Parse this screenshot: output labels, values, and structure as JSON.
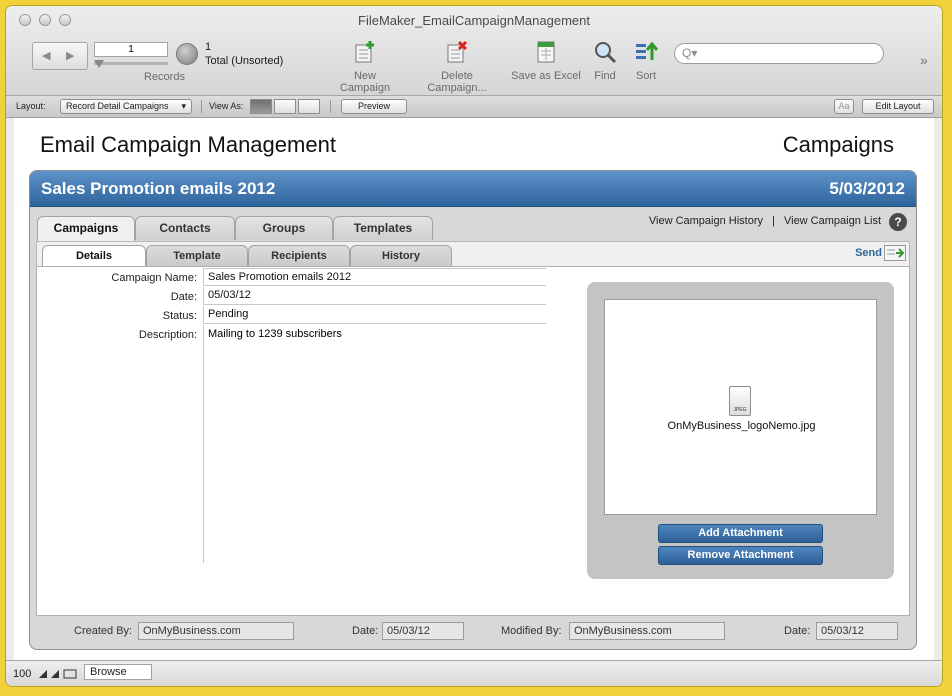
{
  "window": {
    "title": "FileMaker_EmailCampaignManagement"
  },
  "toolbar": {
    "record_number": "1",
    "record_count": "1",
    "found_status": "Total (Unsorted)",
    "records_label": "Records",
    "new_campaign": "New Campaign",
    "delete_campaign": "Delete Campaign...",
    "save_excel": "Save as Excel",
    "find": "Find",
    "sort": "Sort",
    "search_placeholder": "Q▾"
  },
  "layoutbar": {
    "layout_label": "Layout:",
    "layout_value": "Record Detail Campaigns",
    "view_as_label": "View As:",
    "preview": "Preview",
    "aa": "Aa",
    "edit_layout": "Edit Layout"
  },
  "header": {
    "title": "Email Campaign Management",
    "section": "Campaigns"
  },
  "campaign": {
    "name": "Sales Promotion emails 2012",
    "date": "5/03/2012"
  },
  "main_tabs": [
    "Campaigns",
    "Contacts",
    "Groups",
    "Templates"
  ],
  "links": {
    "history": "View Campaign History",
    "separator": "|",
    "list": "View Campaign List",
    "help": "?"
  },
  "sub_tabs": [
    "Details",
    "Template",
    "Recipients",
    "History"
  ],
  "send_label": "Send",
  "fields": {
    "name_label": "Campaign Name:",
    "name_value": "Sales Promotion emails 2012",
    "date_label": "Date:",
    "date_value": "05/03/12",
    "status_label": "Status:",
    "status_value": "Pending",
    "desc_label": "Description:",
    "desc_value": "Mailing to 1239 subscribers"
  },
  "attachment": {
    "file_type": "JPEG",
    "file_name": "OnMyBusiness_logoNemo.jpg",
    "add_button": "Add Attachment",
    "remove_button": "Remove Attachment"
  },
  "footer": {
    "created_by_label": "Created By:",
    "created_by": "OnMyBusiness.com",
    "created_date_label": "Date:",
    "created_date": "05/03/12",
    "modified_by_label": "Modified By:",
    "modified_by": "OnMyBusiness.com",
    "modified_date_label": "Date:",
    "modified_date": "05/03/12"
  },
  "statusbar": {
    "zoom": "100",
    "mode": "Browse"
  }
}
